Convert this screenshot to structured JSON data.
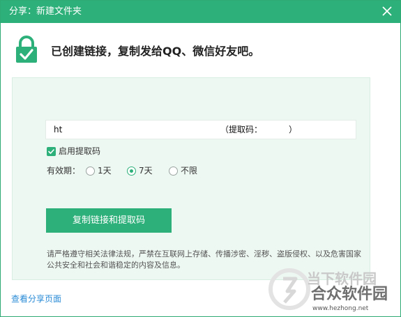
{
  "window": {
    "title": "分享：新建文件夹",
    "close_icon": "close-icon"
  },
  "header": {
    "icon": "lock-check-icon",
    "message": "已创建链接，复制发给QQ、微信好友吧。"
  },
  "link": {
    "url_text": "ht",
    "code_label": "（提取码：",
    "code_close": "）"
  },
  "options": {
    "enable_code_label": "启用提取码",
    "enable_code_checked": true,
    "validity_label": "有效期：",
    "validity_options": [
      {
        "label": "1天",
        "checked": false
      },
      {
        "label": "7天",
        "checked": true
      },
      {
        "label": "不限",
        "checked": false
      }
    ]
  },
  "actions": {
    "copy_button": "复制链接和提取码",
    "view_share_page": "查看分享页面"
  },
  "notice": "请严格遵守相关法律法规，严禁在互联网上存储、传播涉密、淫秽、盗版侵权、以及危害国家公共安全和社会和谐稳定的内容及信息。",
  "watermark": {
    "line1": "当下软件园",
    "line2": "合众软件园",
    "line3": "www.hezhong.net"
  },
  "colors": {
    "accent": "#2eb07a",
    "panel_bg": "#eef8f2",
    "link": "#2a8bd6"
  }
}
